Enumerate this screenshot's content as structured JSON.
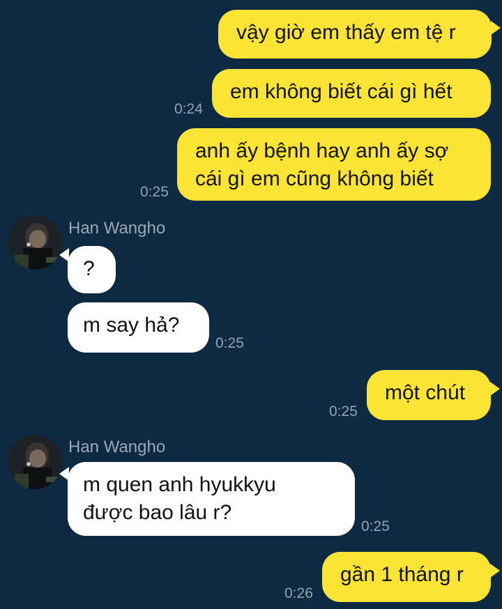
{
  "conversation": {
    "contact_name": "Han Wangho",
    "messages": [
      {
        "from": "me",
        "text": "vậy giờ em thấy em tệ r",
        "time": ""
      },
      {
        "from": "me",
        "text": "em không biết cái gì hết",
        "time": "0:24"
      },
      {
        "from": "me",
        "text": "anh ấy bệnh hay anh ấy sợ\ncái gì em cũng không biết",
        "time": "0:25"
      },
      {
        "from": "them",
        "text": "?",
        "time": ""
      },
      {
        "from": "them",
        "text": "m say hả?",
        "time": "0:25"
      },
      {
        "from": "me",
        "text": "một chút",
        "time": "0:25"
      },
      {
        "from": "them",
        "text": "m quen anh hyukkyu\nđược bao lâu r?",
        "time": "0:25"
      },
      {
        "from": "me",
        "text": "gần 1 tháng r",
        "time": "0:26"
      }
    ]
  },
  "colors": {
    "background": "#0e2a42",
    "my_bubble": "#fbe434",
    "their_bubble": "#ffffff",
    "timestamp": "#93a3b2"
  },
  "icons": {
    "avatar": "contact-profile-photo"
  }
}
